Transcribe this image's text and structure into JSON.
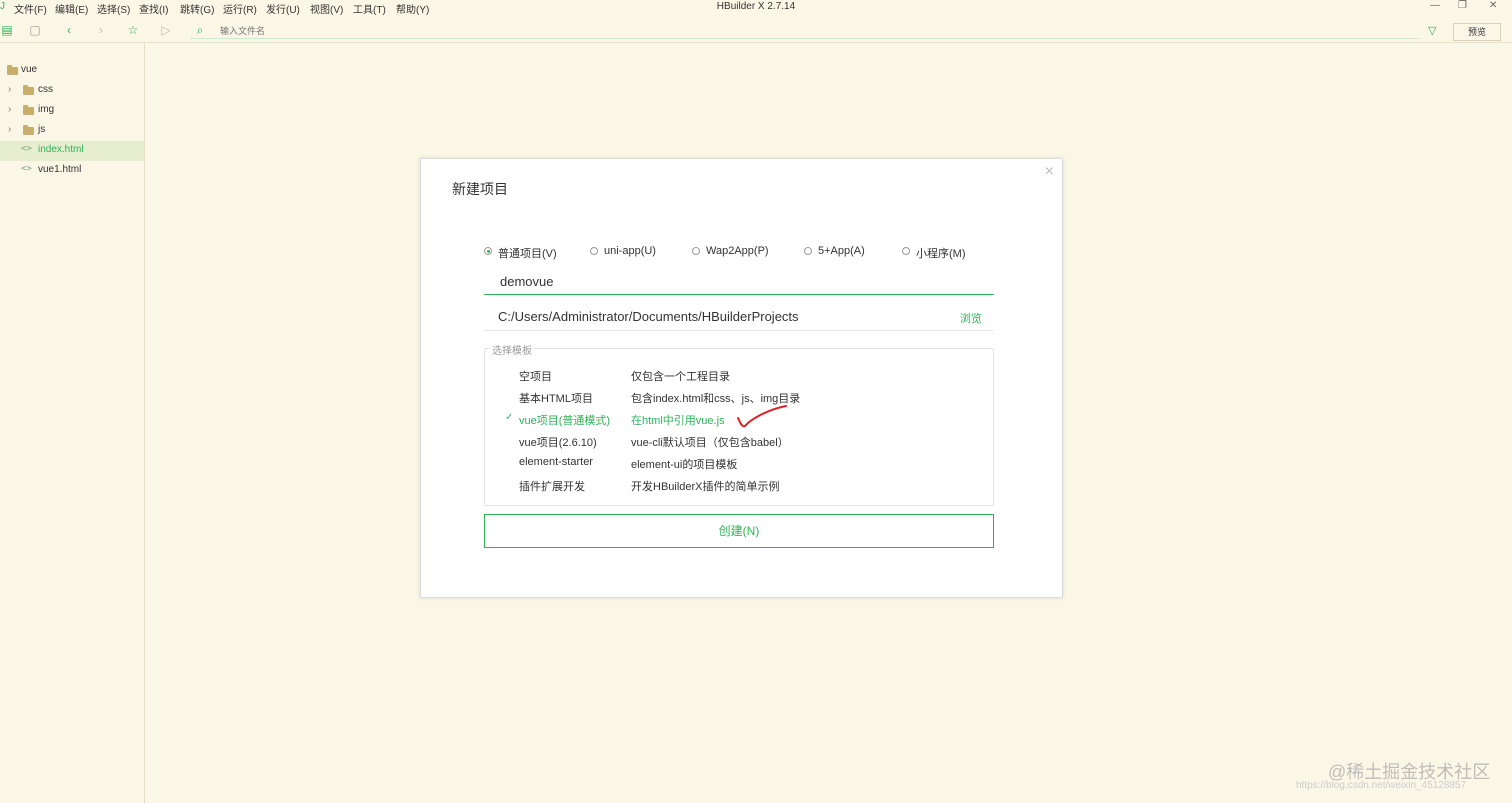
{
  "app": {
    "title": "HBuilder X 2.7.14"
  },
  "menu": {
    "items": [
      "文件(F)",
      "编辑(E)",
      "选择(S)",
      "查找(I)",
      "跳转(G)",
      "运行(R)",
      "发行(U)",
      "视图(V)",
      "工具(T)",
      "帮助(Y)"
    ]
  },
  "window_controls": {
    "minimize": "—",
    "restore": "❐",
    "close": "✕"
  },
  "toolbar": {
    "file_input_placeholder": "输入文件名",
    "preview_label": "预览"
  },
  "sidebar": {
    "root": "vue",
    "items": [
      {
        "label": "css",
        "type": "folder"
      },
      {
        "label": "img",
        "type": "folder"
      },
      {
        "label": "js",
        "type": "folder"
      },
      {
        "label": "index.html",
        "type": "file",
        "selected": true
      },
      {
        "label": "vue1.html",
        "type": "file"
      }
    ]
  },
  "dialog": {
    "title": "新建项目",
    "close": "×",
    "project_types": [
      {
        "label": "普通项目(V)",
        "checked": true
      },
      {
        "label": "uni-app(U)",
        "checked": false
      },
      {
        "label": "Wap2App(P)",
        "checked": false
      },
      {
        "label": "5+App(A)",
        "checked": false
      },
      {
        "label": "小程序(M)",
        "checked": false
      }
    ],
    "project_name": "demovue",
    "path": "C:/Users/Administrator/Documents/HBuilderProjects",
    "browse_label": "浏览",
    "template_legend": "选择模板",
    "templates": [
      {
        "name": "空项目",
        "desc": "仅包含一个工程目录",
        "selected": false
      },
      {
        "name": "基本HTML项目",
        "desc": "包含index.html和css、js、img目录",
        "selected": false
      },
      {
        "name": "vue项目(普通模式)",
        "desc": "在html中引用vue.js",
        "selected": true,
        "check": "✓"
      },
      {
        "name": "vue项目(2.6.10)",
        "desc": "vue-cli默认项目（仅包含babel）",
        "selected": false
      },
      {
        "name": "element-starter",
        "desc": "element-ui的项目模板",
        "selected": false
      },
      {
        "name": "插件扩展开发",
        "desc": "开发HBuilderX插件的简单示例",
        "selected": false
      }
    ],
    "create_label": "创建(N)"
  },
  "watermark": {
    "text": "@稀土掘金技术社区",
    "url": "https://blog.csdn.net/weixin_45128857"
  },
  "colors": {
    "accent": "#2fb35a",
    "background": "#fbf7e6",
    "annotation": "#e0202a"
  }
}
